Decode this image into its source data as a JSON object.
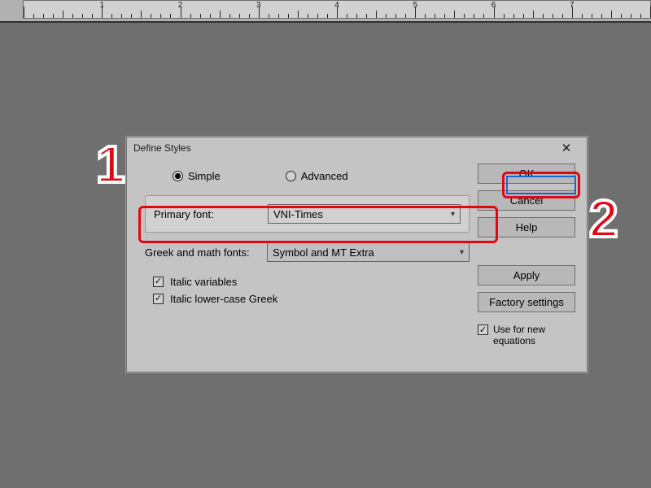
{
  "dialog": {
    "title": "Define Styles",
    "tabs": {
      "simple": "Simple",
      "advanced": "Advanced",
      "selected": "simple"
    },
    "primary": {
      "label": "Primary font:",
      "value": "VNI-Times"
    },
    "greek": {
      "label": "Greek and math fonts:",
      "value": "Symbol and MT Extra"
    },
    "checks": {
      "italic_vars": "Italic variables",
      "italic_greek": "Italic lower-case Greek"
    },
    "buttons": {
      "ok": "OK",
      "cancel": "Cancel",
      "help": "Help",
      "apply": "Apply",
      "factory": "Factory settings"
    },
    "use_new": "Use for new equations"
  },
  "ruler": {
    "majors": [
      "1",
      "2",
      "3",
      "4",
      "5",
      "6",
      "7"
    ]
  },
  "steps": {
    "one": "1",
    "two": "2"
  }
}
